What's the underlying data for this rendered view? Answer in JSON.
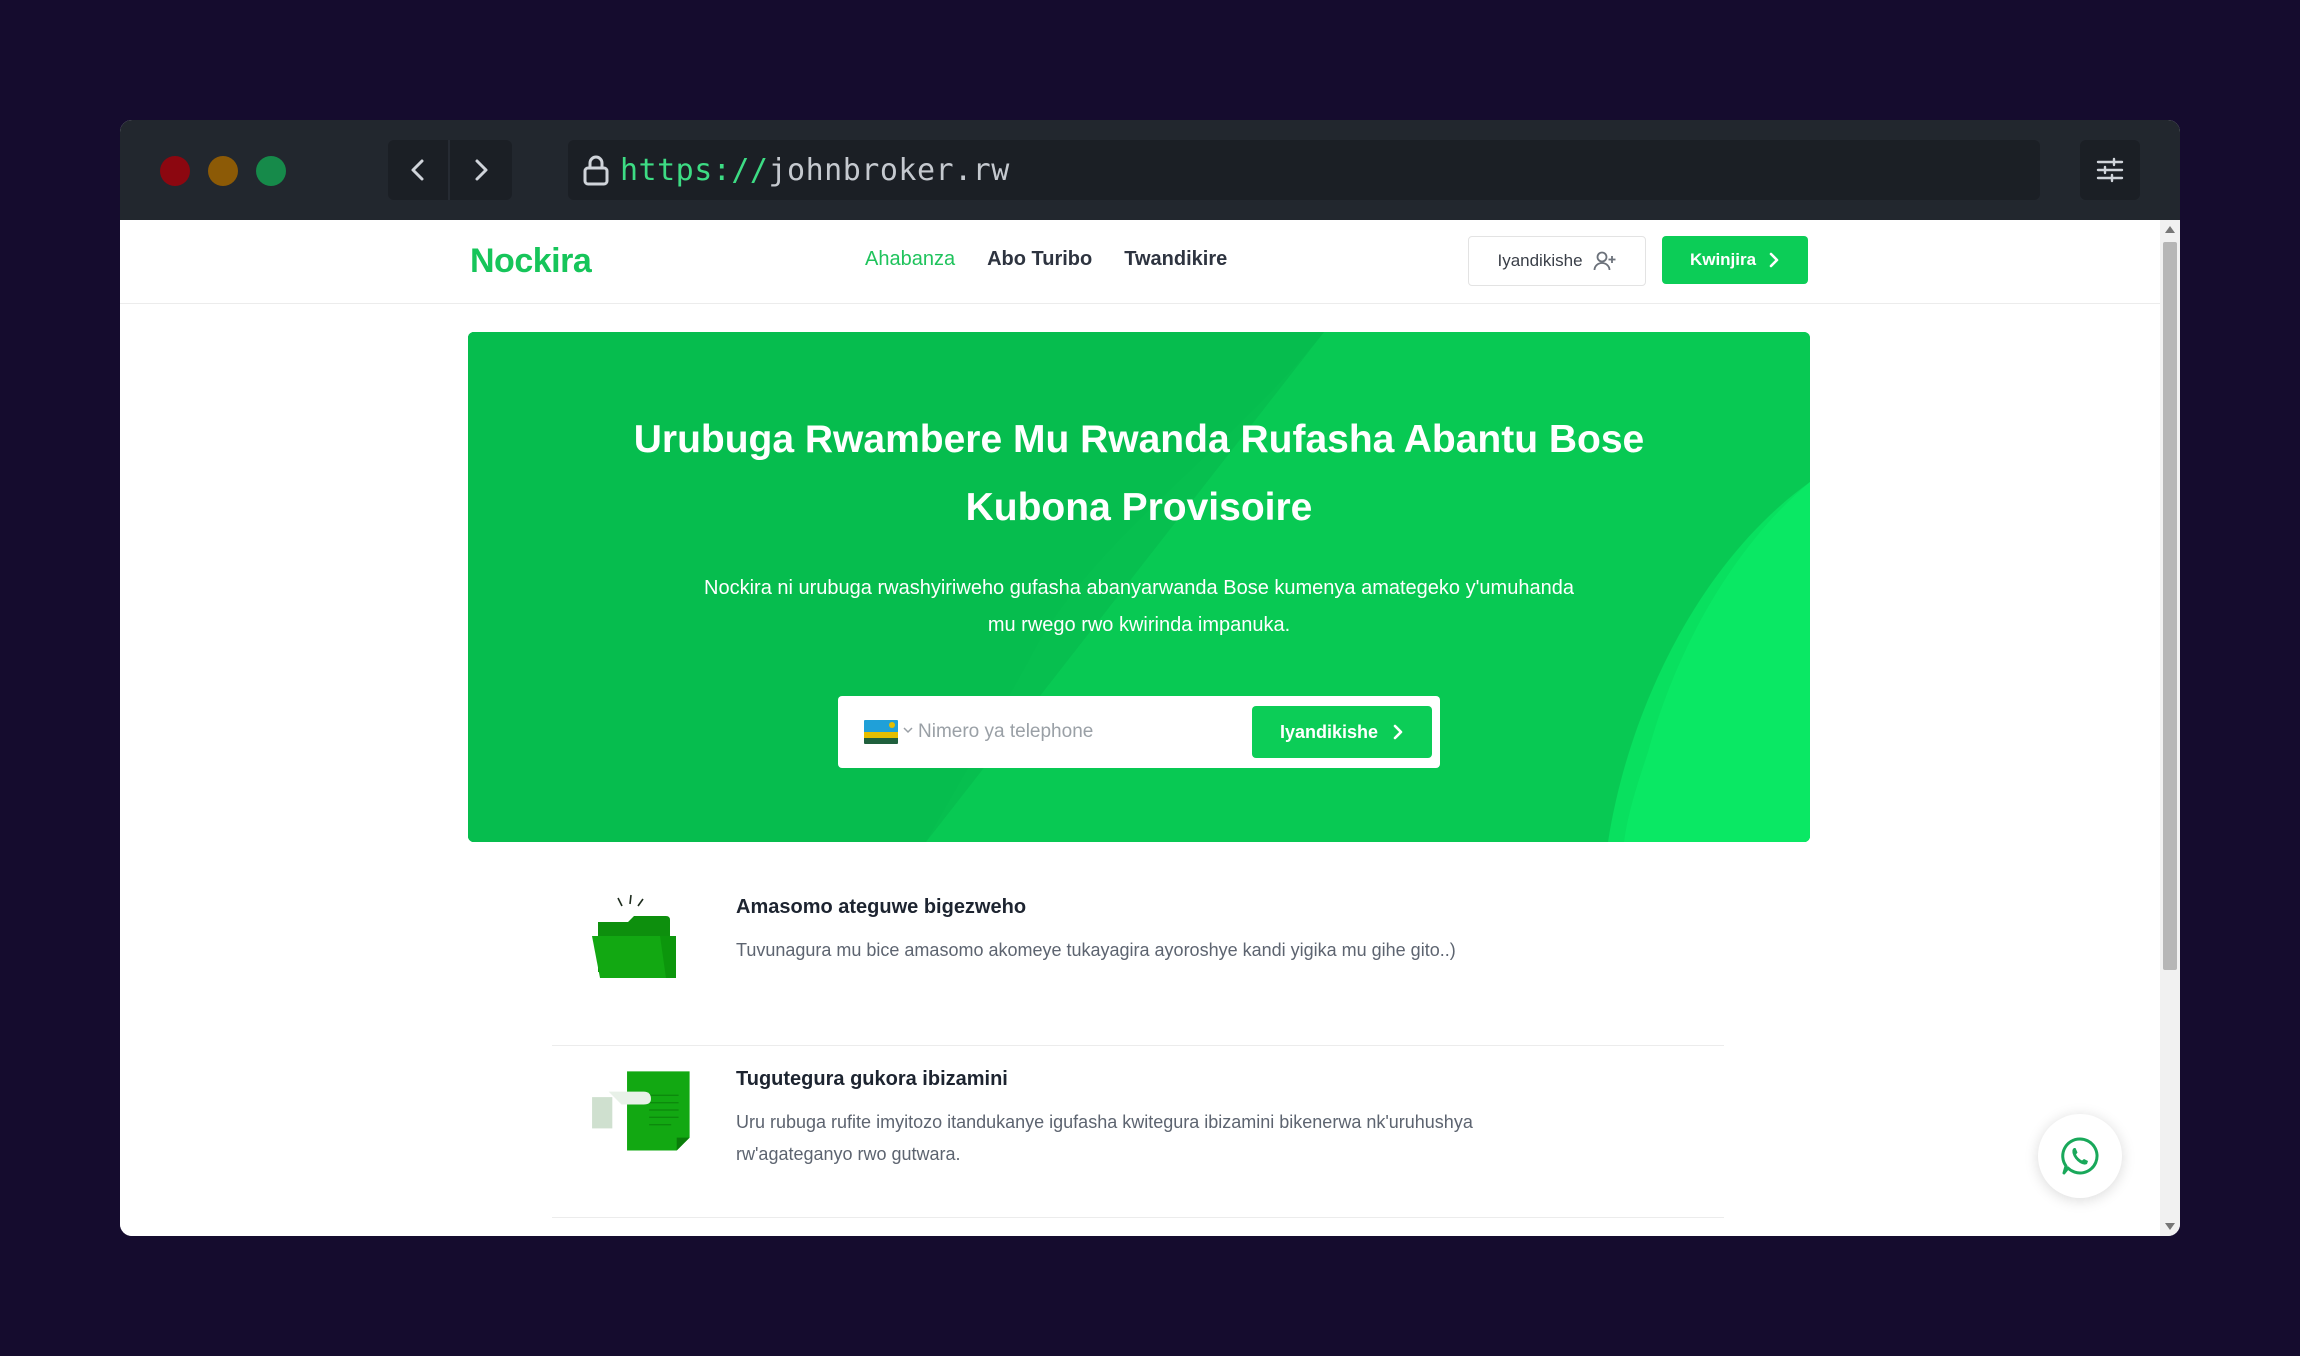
{
  "browser": {
    "url_scheme": "https://",
    "url_host": "johnbroker.rw",
    "colors": {
      "close": "#8c0710",
      "minimize": "#8c5a06",
      "maximize": "#168a4a"
    }
  },
  "header": {
    "logo": "Nockira",
    "nav": [
      {
        "label": "Ahabanza",
        "active": true
      },
      {
        "label": "Abo Turibo",
        "active": false
      },
      {
        "label": "Twandikire",
        "active": false
      }
    ],
    "register_label": "Iyandikishe",
    "login_label": "Kwinjira"
  },
  "hero": {
    "title": "Urubuga Rwambere Mu Rwanda Rufasha Abantu Bose Kubona Provisoire",
    "subtitle": "Nockira ni urubuga rwashyiriweho gufasha abanyarwanda Bose kumenya amategeko y'umuhanda mu rwego rwo kwirinda impanuka.",
    "phone_placeholder": "Nimero ya telephone",
    "register_label": "Iyandikishe",
    "brand_color": "#08cc55"
  },
  "features": [
    {
      "title": "Amasomo ateguwe bigezweho",
      "description": "Tuvunagura mu bice amasomo akomeye tukayagira ayoroshye kandi yigika mu gihe gito..)",
      "icon": "folder-icon"
    },
    {
      "title": "Tugutegura gukora ibizamini",
      "description": "Uru rubuga rufite imyitozo itandukanye igufasha kwitegura ibizamini bikenerwa nk'uruhushya rw'agateganyo rwo gutwara.",
      "icon": "document-icon"
    }
  ]
}
